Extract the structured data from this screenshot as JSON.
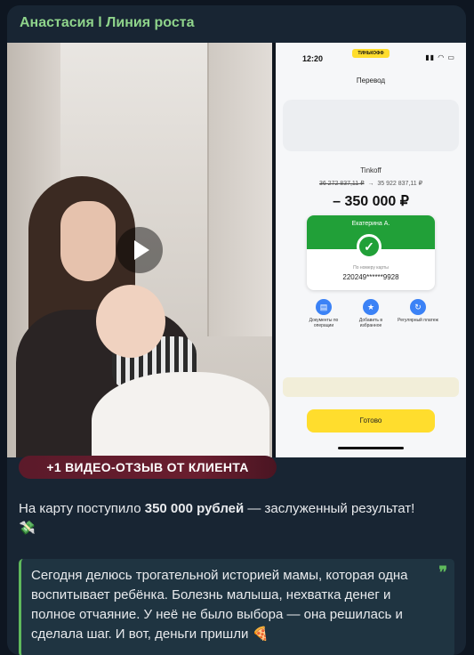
{
  "sender": {
    "name": "Анастасия l Линия роста",
    "color": "#8fd48b"
  },
  "video": {
    "play_icon": "play-icon"
  },
  "phone_screenshot": {
    "time": "12:20",
    "brand": "ТИНЬКОФФ",
    "title": "Перевод",
    "bank": "Tinkoff",
    "balance_before": "36 272 837,11 ₽",
    "balance_arrow": "→",
    "balance_after": "35 922 837,11 ₽",
    "amount": "– 350 000 ₽",
    "recipient": "Екатерина А.",
    "card_label": "По номеру карты",
    "card_number": "220249******9928",
    "actions": [
      {
        "icon": "document-icon",
        "label": "Документы по операции"
      },
      {
        "icon": "star-icon",
        "label": "Добавить в избранное"
      },
      {
        "icon": "repeat-icon",
        "label": "Регулярный платеж"
      }
    ],
    "done_button": "Готово",
    "accent_yellow": "#ffdd2d",
    "accent_green": "#21a038"
  },
  "badge": {
    "text": "+1 ВИДЕО-ОТЗЫВ ОТ КЛИЕНТА"
  },
  "message": {
    "before": "На карту поступило ",
    "bold": "350 000 рублей",
    "after": " — заслуженный результат!",
    "emoji": "💸"
  },
  "quote": {
    "text": "Сегодня делюсь трогательной историей мамы, которая одна воспитывает ребёнка. Болезнь малыша, нехватка денег и полное отчаяние. У неё не было выбора — она решилась и сделала шаг. И вот, деньги пришли",
    "emoji": "🍕",
    "mark": "❞"
  }
}
